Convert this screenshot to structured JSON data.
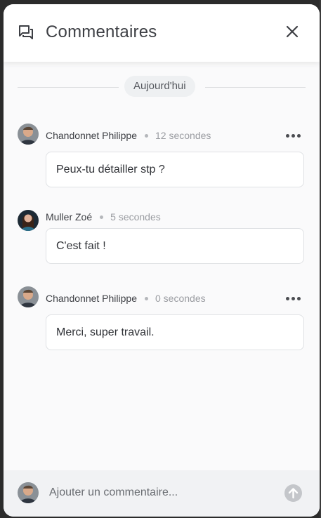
{
  "panel": {
    "title": "Commentaires",
    "title_icon": "forum-icon",
    "close_icon": "close-icon"
  },
  "day_separator": "Aujourd'hui",
  "comments": [
    {
      "author": "Chandonnet Philippe",
      "time": "12 secondes",
      "text": "Peux-tu détailler stp ?",
      "has_menu": true,
      "avatar": "avatar-man"
    },
    {
      "author": "Muller Zoé",
      "time": "5 secondes",
      "text": "C'est fait !",
      "has_menu": false,
      "avatar": "avatar-woman"
    },
    {
      "author": "Chandonnet Philippe",
      "time": "0 secondes",
      "text": "Merci, super travail.",
      "has_menu": true,
      "avatar": "avatar-man"
    }
  ],
  "composer": {
    "placeholder": "Ajouter un commentaire...",
    "value": "",
    "send_icon": "arrow-up-icon"
  },
  "colors": {
    "panel_bg": "#fafafb",
    "header_bg": "#ffffff",
    "footer_bg": "#f1f2f4",
    "text": "#3d3f44",
    "muted": "#9a9ca1"
  }
}
